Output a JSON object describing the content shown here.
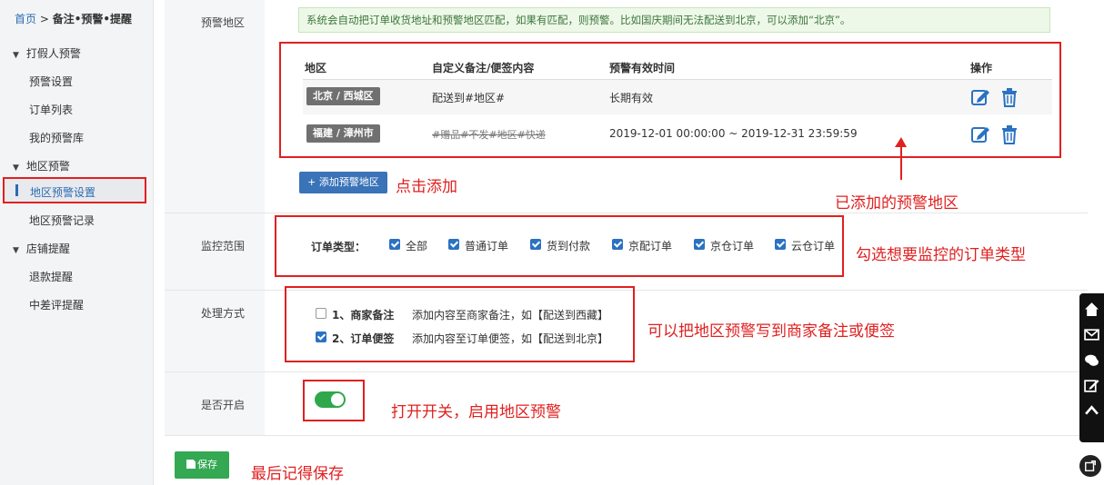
{
  "breadcrumb": {
    "home": "首页",
    "sep": " > ",
    "current": "备注•预警•提醒"
  },
  "sidebar": {
    "groups": [
      {
        "label": "打假人预警",
        "items": [
          "预警设置",
          "订单列表",
          "我的预警库"
        ]
      },
      {
        "label": "地区预警",
        "items": [
          "地区预警设置",
          "地区预警记录"
        ]
      },
      {
        "label": "店铺提醒",
        "items": [
          "退款提醒",
          "中差评提醒"
        ]
      }
    ],
    "active_item": "地区预警设置"
  },
  "region_section": {
    "label": "预警地区",
    "hint": "系统会自动把订单收货地址和预警地区匹配，如果有匹配，则预警。比如国庆期间无法配送到北京，可以添加“北京”。",
    "columns": [
      "地区",
      "自定义备注/便签内容",
      "预警有效时间",
      "操作"
    ],
    "rows": [
      {
        "region": "北京 / 西城区",
        "note": "配送到#地区#",
        "valid": "长期有效"
      },
      {
        "region": "福建 / 漳州市",
        "note": "#赠品#不发#地区#快递",
        "valid": "2019-12-01 00:00:00 ~ 2019-12-31 23:59:59"
      }
    ],
    "add_button": "+ 添加预警地区",
    "annotation_add": "点击添加",
    "annotation_added": "已添加的预警地区"
  },
  "monitor_section": {
    "label": "监控范围",
    "order_type_label": "订单类型：",
    "options": [
      "全部",
      "普通订单",
      "货到付款",
      "京配订单",
      "京仓订单",
      "云仓订单"
    ],
    "checked": [
      true,
      true,
      true,
      true,
      true,
      true
    ],
    "annotation": "勾选想要监控的订单类型"
  },
  "handle_section": {
    "label": "处理方式",
    "options": [
      {
        "title": "1、商家备注",
        "desc": "添加内容至商家备注，如【配送到西藏】",
        "checked": false
      },
      {
        "title": "2、订单便签",
        "desc": "添加内容至订单便签，如【配送到北京】",
        "checked": true
      }
    ],
    "annotation": "可以把地区预警写到商家备注或便签"
  },
  "enable_section": {
    "label": "是否开启",
    "enabled": true,
    "annotation": "打开开关，启用地区预警"
  },
  "save": {
    "label": "保存",
    "annotation": "最后记得保存"
  },
  "floating_icons": [
    "home-icon",
    "mail-icon",
    "chat-icon",
    "edit-icon",
    "up-icon",
    "share-icon"
  ],
  "colors": {
    "accent_blue": "#3a73b8",
    "alert_red": "#e02020",
    "save_green": "#34a853",
    "toggle_green": "#2ea84a"
  }
}
